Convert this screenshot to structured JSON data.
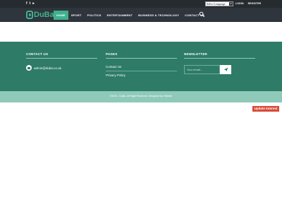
{
  "topbar": {
    "social": [
      {
        "icon": "facebook-icon",
        "glyph": "f"
      },
      {
        "icon": "twitter-icon",
        "glyph": "t"
      },
      {
        "icon": "youtube-icon",
        "glyph": "▸"
      }
    ],
    "language_select": "Select Language",
    "login": "LOGIN",
    "register": "REGISTER"
  },
  "brand": {
    "name": "DuBa",
    "accent": "#3fb18d"
  },
  "nav": {
    "items": [
      "HOME",
      "SPORT",
      "POLITICS",
      "ENTERTAINMENT",
      "BUSINESS & TECHNOLOGY",
      "CONTACT US"
    ],
    "active_index": 0
  },
  "footer": {
    "contact": {
      "title": "CONTACT US",
      "email": "admin@duba.co.uk"
    },
    "pages": {
      "title": "PAGES",
      "links": [
        "Contact Us",
        "Privacy Policy"
      ]
    },
    "newsletter": {
      "title": "NEWSLETTER",
      "placeholder": "Your email..."
    },
    "copyright": "©2020 - DuBa. All Right Reserved. Designed by Helbenit",
    "colors": {
      "footer_bg": "#2e7b68",
      "copy_bg": "#8fcab9"
    }
  },
  "widget": {
    "update_label": "Update Interest",
    "color": "#d94a36"
  }
}
